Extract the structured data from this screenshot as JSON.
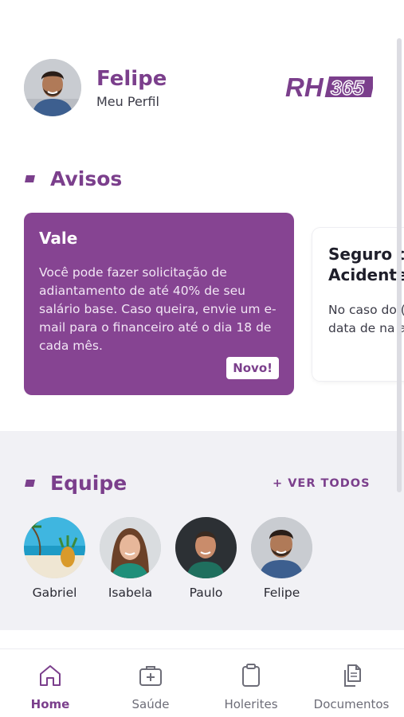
{
  "profile": {
    "name": "Felipe",
    "subtitle": "Meu Perfil"
  },
  "brand": {
    "logo_text": "RH365",
    "color": "#7b3f8c"
  },
  "notices": {
    "title": "Avisos",
    "cards": [
      {
        "title": "Vale",
        "body": "Você pode fazer solicitação de adiantamento de até 40% de seu salário base. Caso queira, envie um e-mail para o financeiro até o dia 18 de cada mês.",
        "badge": "Novo!"
      },
      {
        "title": "Seguro de Acidentes",
        "body": "No caso do (a), você te data de na a Central d"
      }
    ]
  },
  "team": {
    "title": "Equipe",
    "see_all": "+ VER TODOS",
    "members": [
      {
        "name": "Gabriel"
      },
      {
        "name": "Isabela"
      },
      {
        "name": "Paulo"
      },
      {
        "name": "Felipe"
      }
    ]
  },
  "nav": {
    "items": [
      {
        "label": "Home",
        "icon": "home-icon",
        "active": true
      },
      {
        "label": "Saúde",
        "icon": "medical-kit-icon"
      },
      {
        "label": "Holerites",
        "icon": "clipboard-icon"
      },
      {
        "label": "Documentos",
        "icon": "documents-icon"
      }
    ]
  },
  "colors": {
    "accent": "#7b3f8c",
    "card": "#864492",
    "section_bg": "#f1f1f5"
  }
}
